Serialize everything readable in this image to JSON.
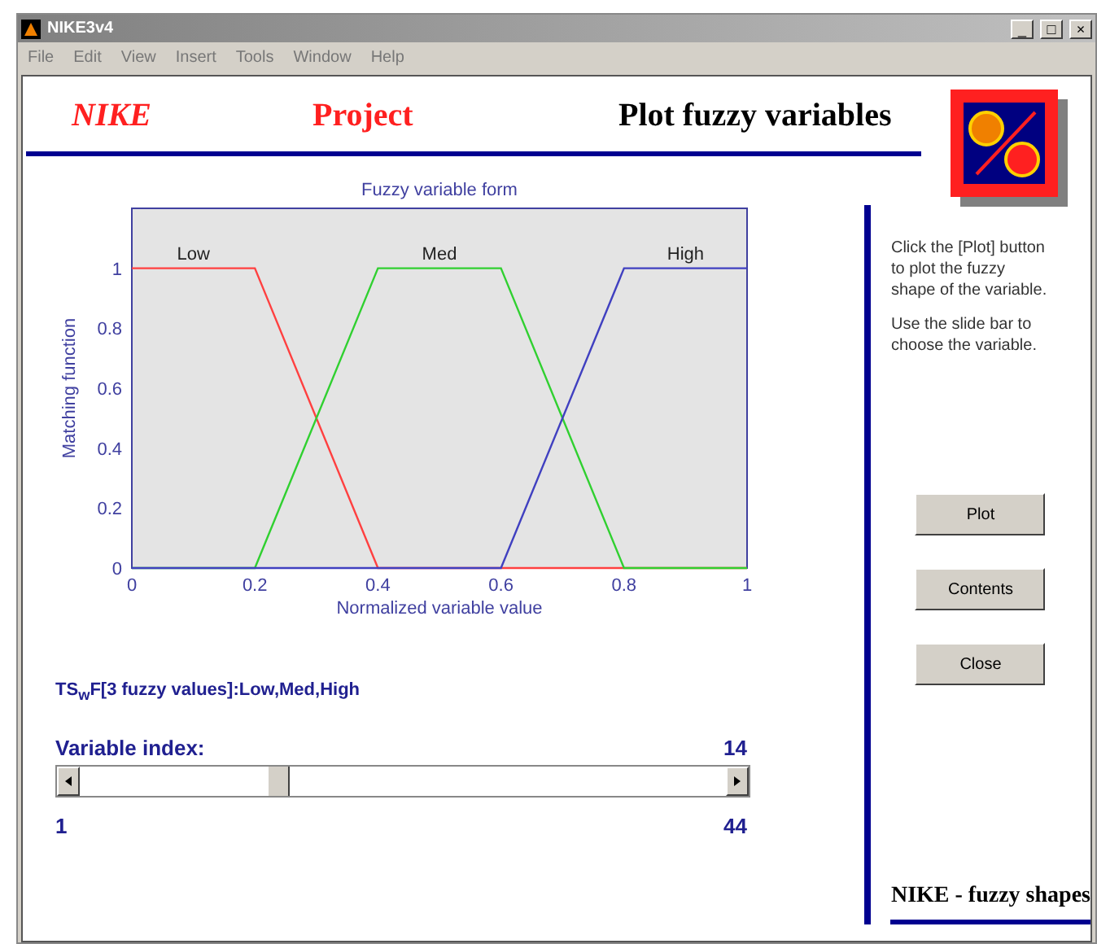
{
  "window": {
    "title": "NIKE3v4",
    "controls": [
      "_",
      "□",
      "×"
    ]
  },
  "menu": [
    "File",
    "Edit",
    "View",
    "Insert",
    "Tools",
    "Window",
    "Help"
  ],
  "header": {
    "brand": "NIKE",
    "project": "Project",
    "title": "Plot fuzzy variables"
  },
  "plot": {
    "chart_data": {
      "type": "line",
      "title": "Fuzzy variable form",
      "xlabel": "Normalized variable value",
      "ylabel": "Matching function",
      "x": [
        0,
        0.2,
        0.4,
        0.6,
        0.8,
        1
      ],
      "series": [
        {
          "name": "Low",
          "color": "#ff4040",
          "values": [
            1,
            1,
            0,
            0,
            0,
            0
          ]
        },
        {
          "name": "Med",
          "color": "#30d030",
          "values": [
            0,
            0,
            1,
            1,
            0,
            0
          ]
        },
        {
          "name": "High",
          "color": "#4040c0",
          "values": [
            0,
            0,
            0,
            0,
            1,
            1
          ]
        }
      ],
      "xlim": [
        0,
        1
      ],
      "ylim": [
        0,
        1.2
      ],
      "xticks": [
        0,
        0.2,
        0.4,
        0.6,
        0.8,
        1
      ],
      "yticks": [
        0,
        0.2,
        0.4,
        0.6,
        0.8,
        1
      ]
    }
  },
  "variable_info": "TS$_{w}$F[3 fuzzy values]:Low,Med,High",
  "slider": {
    "label": "Variable index:",
    "value": "14",
    "level": 0.3,
    "min": "1",
    "max": "44"
  },
  "help": [
    "Click the [Plot] button to plot the fuzzy shape of the variable.",
    "Use the slide bar to choose the variable."
  ],
  "buttons": [
    "Plot",
    "Contents",
    "Close"
  ],
  "footer": "NIKE - fuzzy shapes"
}
